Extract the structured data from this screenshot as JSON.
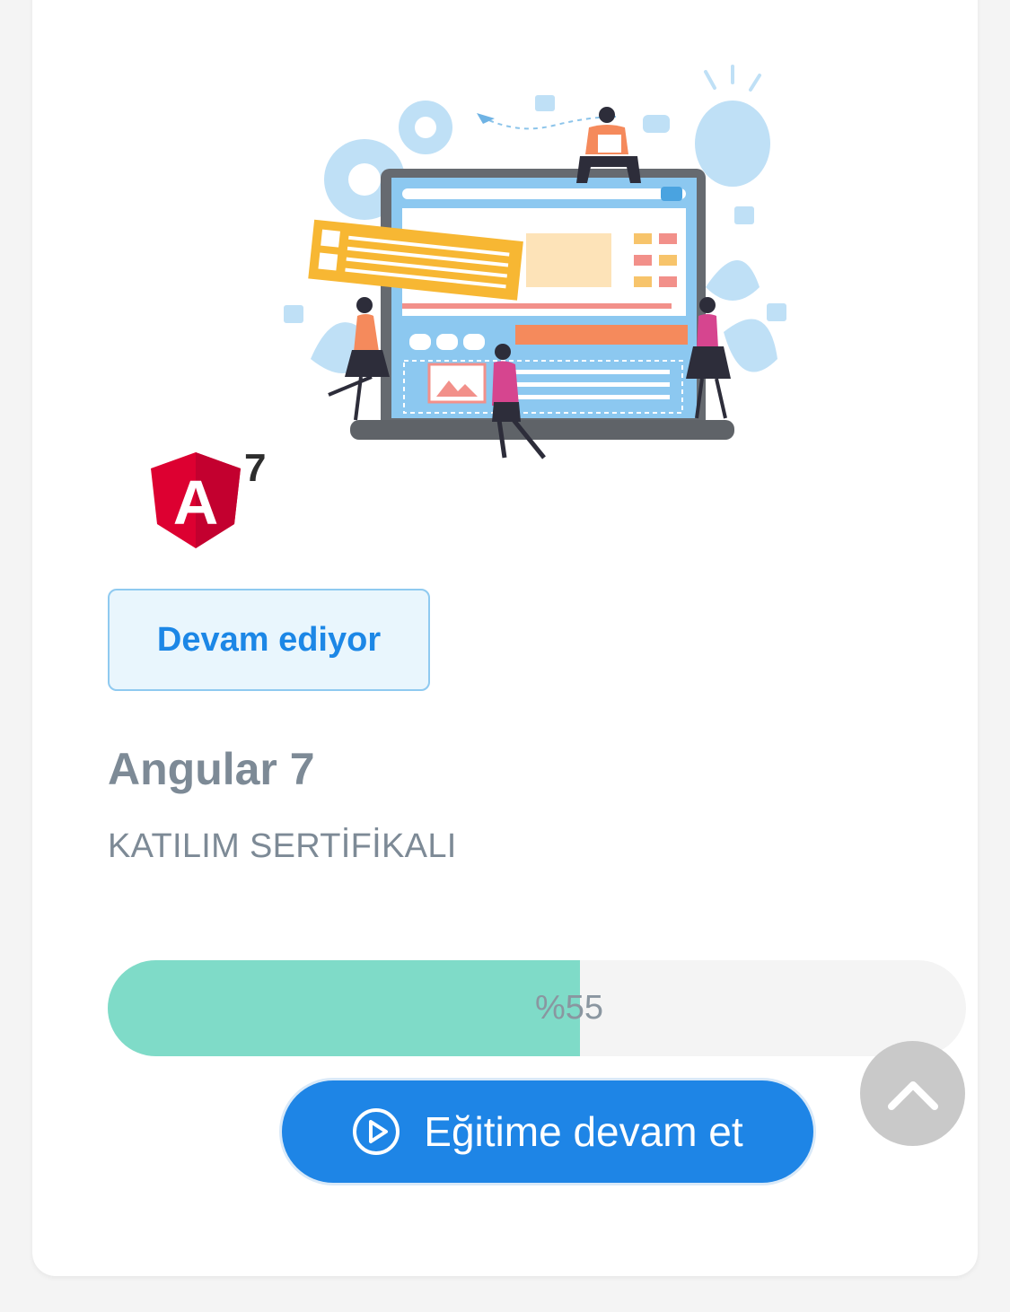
{
  "course": {
    "status_label": "Devam ediyor",
    "title": "Angular 7",
    "subtitle": "KATILIM SERTİFİKALI",
    "progress_percent": 55,
    "progress_label": "%55",
    "continue_label": "Eğitime devam et",
    "logo_text": "A",
    "logo_version": "7"
  },
  "icons": {
    "continue": "play-circle-icon",
    "scroll_top": "chevron-up-icon"
  },
  "colors": {
    "accent": "#1e85e6",
    "progress_fill": "#7fdbc8",
    "badge_border": "#8fcaf0",
    "badge_bg": "#e9f6fd",
    "angular_red": "#dd0031"
  }
}
